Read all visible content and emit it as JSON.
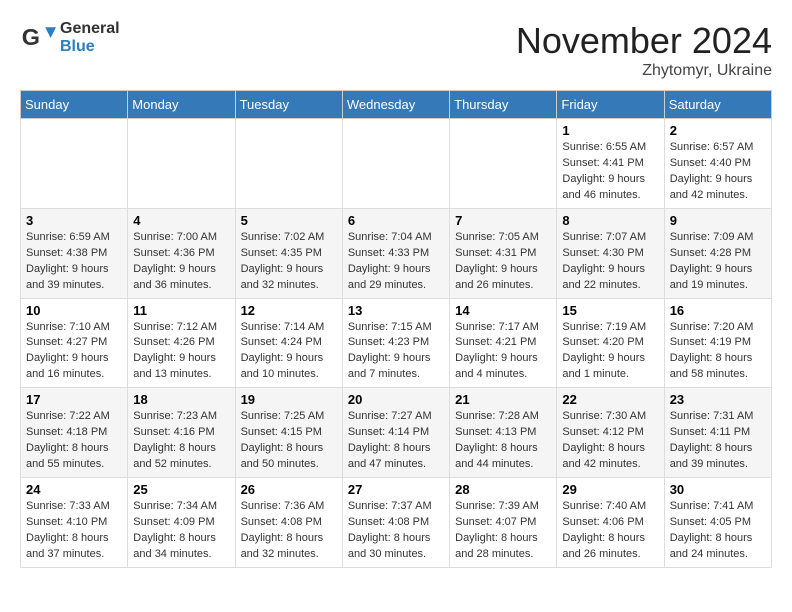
{
  "header": {
    "logo_general": "General",
    "logo_blue": "Blue",
    "month_year": "November 2024",
    "location": "Zhytomyr, Ukraine"
  },
  "weekdays": [
    "Sunday",
    "Monday",
    "Tuesday",
    "Wednesday",
    "Thursday",
    "Friday",
    "Saturday"
  ],
  "weeks": [
    [
      {
        "day": "",
        "detail": ""
      },
      {
        "day": "",
        "detail": ""
      },
      {
        "day": "",
        "detail": ""
      },
      {
        "day": "",
        "detail": ""
      },
      {
        "day": "",
        "detail": ""
      },
      {
        "day": "1",
        "detail": "Sunrise: 6:55 AM\nSunset: 4:41 PM\nDaylight: 9 hours and 46 minutes."
      },
      {
        "day": "2",
        "detail": "Sunrise: 6:57 AM\nSunset: 4:40 PM\nDaylight: 9 hours and 42 minutes."
      }
    ],
    [
      {
        "day": "3",
        "detail": "Sunrise: 6:59 AM\nSunset: 4:38 PM\nDaylight: 9 hours and 39 minutes."
      },
      {
        "day": "4",
        "detail": "Sunrise: 7:00 AM\nSunset: 4:36 PM\nDaylight: 9 hours and 36 minutes."
      },
      {
        "day": "5",
        "detail": "Sunrise: 7:02 AM\nSunset: 4:35 PM\nDaylight: 9 hours and 32 minutes."
      },
      {
        "day": "6",
        "detail": "Sunrise: 7:04 AM\nSunset: 4:33 PM\nDaylight: 9 hours and 29 minutes."
      },
      {
        "day": "7",
        "detail": "Sunrise: 7:05 AM\nSunset: 4:31 PM\nDaylight: 9 hours and 26 minutes."
      },
      {
        "day": "8",
        "detail": "Sunrise: 7:07 AM\nSunset: 4:30 PM\nDaylight: 9 hours and 22 minutes."
      },
      {
        "day": "9",
        "detail": "Sunrise: 7:09 AM\nSunset: 4:28 PM\nDaylight: 9 hours and 19 minutes."
      }
    ],
    [
      {
        "day": "10",
        "detail": "Sunrise: 7:10 AM\nSunset: 4:27 PM\nDaylight: 9 hours and 16 minutes."
      },
      {
        "day": "11",
        "detail": "Sunrise: 7:12 AM\nSunset: 4:26 PM\nDaylight: 9 hours and 13 minutes."
      },
      {
        "day": "12",
        "detail": "Sunrise: 7:14 AM\nSunset: 4:24 PM\nDaylight: 9 hours and 10 minutes."
      },
      {
        "day": "13",
        "detail": "Sunrise: 7:15 AM\nSunset: 4:23 PM\nDaylight: 9 hours and 7 minutes."
      },
      {
        "day": "14",
        "detail": "Sunrise: 7:17 AM\nSunset: 4:21 PM\nDaylight: 9 hours and 4 minutes."
      },
      {
        "day": "15",
        "detail": "Sunrise: 7:19 AM\nSunset: 4:20 PM\nDaylight: 9 hours and 1 minute."
      },
      {
        "day": "16",
        "detail": "Sunrise: 7:20 AM\nSunset: 4:19 PM\nDaylight: 8 hours and 58 minutes."
      }
    ],
    [
      {
        "day": "17",
        "detail": "Sunrise: 7:22 AM\nSunset: 4:18 PM\nDaylight: 8 hours and 55 minutes."
      },
      {
        "day": "18",
        "detail": "Sunrise: 7:23 AM\nSunset: 4:16 PM\nDaylight: 8 hours and 52 minutes."
      },
      {
        "day": "19",
        "detail": "Sunrise: 7:25 AM\nSunset: 4:15 PM\nDaylight: 8 hours and 50 minutes."
      },
      {
        "day": "20",
        "detail": "Sunrise: 7:27 AM\nSunset: 4:14 PM\nDaylight: 8 hours and 47 minutes."
      },
      {
        "day": "21",
        "detail": "Sunrise: 7:28 AM\nSunset: 4:13 PM\nDaylight: 8 hours and 44 minutes."
      },
      {
        "day": "22",
        "detail": "Sunrise: 7:30 AM\nSunset: 4:12 PM\nDaylight: 8 hours and 42 minutes."
      },
      {
        "day": "23",
        "detail": "Sunrise: 7:31 AM\nSunset: 4:11 PM\nDaylight: 8 hours and 39 minutes."
      }
    ],
    [
      {
        "day": "24",
        "detail": "Sunrise: 7:33 AM\nSunset: 4:10 PM\nDaylight: 8 hours and 37 minutes."
      },
      {
        "day": "25",
        "detail": "Sunrise: 7:34 AM\nSunset: 4:09 PM\nDaylight: 8 hours and 34 minutes."
      },
      {
        "day": "26",
        "detail": "Sunrise: 7:36 AM\nSunset: 4:08 PM\nDaylight: 8 hours and 32 minutes."
      },
      {
        "day": "27",
        "detail": "Sunrise: 7:37 AM\nSunset: 4:08 PM\nDaylight: 8 hours and 30 minutes."
      },
      {
        "day": "28",
        "detail": "Sunrise: 7:39 AM\nSunset: 4:07 PM\nDaylight: 8 hours and 28 minutes."
      },
      {
        "day": "29",
        "detail": "Sunrise: 7:40 AM\nSunset: 4:06 PM\nDaylight: 8 hours and 26 minutes."
      },
      {
        "day": "30",
        "detail": "Sunrise: 7:41 AM\nSunset: 4:05 PM\nDaylight: 8 hours and 24 minutes."
      }
    ]
  ]
}
